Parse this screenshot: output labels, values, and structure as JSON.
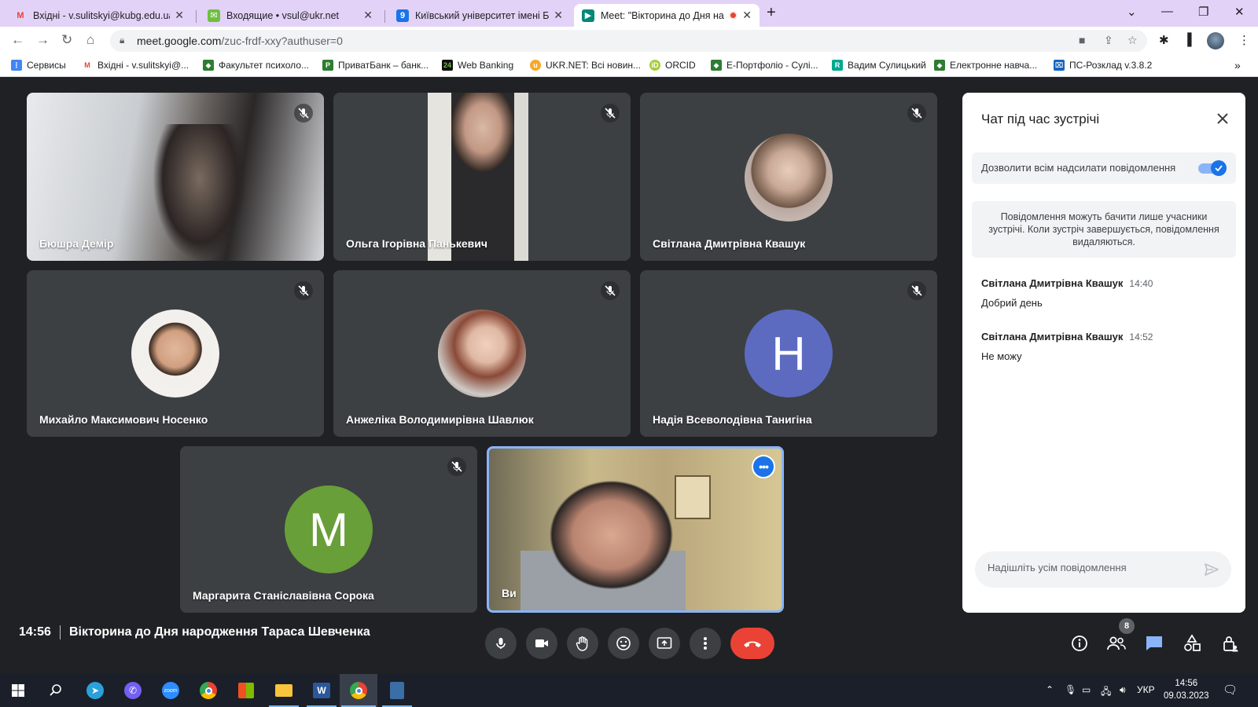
{
  "browser": {
    "tabs": [
      {
        "title": "Вхідні - v.sulitskyi@kubg.edu.ua",
        "icon": "gmail-icon",
        "color": "#ea4335"
      },
      {
        "title": "Входящие • vsul@ukr.net",
        "icon": "ukrnet-mail-icon",
        "color": "#6fbf40"
      },
      {
        "title": "Київський університет імені Бор",
        "icon": "kubg-icon",
        "color": "#1a73e8"
      },
      {
        "title": "Meet: \"Вікторина до Дня на",
        "icon": "meet-icon",
        "color": "#00897b",
        "recording": true
      }
    ],
    "url_host": "meet.google.com",
    "url_path": "/zuc-frdf-xxy?authuser=0",
    "bookmarks": [
      {
        "label": "Сервисы",
        "icon": "apps-grid-icon",
        "color": "#4285f4"
      },
      {
        "label": "Вхідні - v.sulitskyi@...",
        "icon": "gmail-icon",
        "color": "#ea4335"
      },
      {
        "label": "Факультет психоло...",
        "icon": "kubg-icon",
        "color": "#2e7d32"
      },
      {
        "label": "ПриватБанк – банк...",
        "icon": "privatbank-icon",
        "color": "#2e7d32"
      },
      {
        "label": "Web Banking",
        "icon": "bank-icon",
        "color": "#111111"
      },
      {
        "label": "UKR.NET: Всі новин...",
        "icon": "ukrnet-icon",
        "color": "#f9a825"
      },
      {
        "label": "ORCID",
        "icon": "orcid-icon",
        "color": "#a6ce39"
      },
      {
        "label": "Е-Портфоліо - Cулі...",
        "icon": "kubg-icon",
        "color": "#2e7d32"
      },
      {
        "label": "Вадим Сулицький",
        "icon": "researchgate-icon",
        "color": "#00a98f"
      },
      {
        "label": "Електронне навча...",
        "icon": "kubg-icon",
        "color": "#2e7d32"
      },
      {
        "label": "ПС-Розклад v.3.8.2",
        "icon": "schedule-icon",
        "color": "#1565c0"
      }
    ]
  },
  "meet": {
    "participants": [
      {
        "name": "Бюшра Демір",
        "kind": "video"
      },
      {
        "name": "Ольга Ігорівна Панькевич",
        "kind": "video"
      },
      {
        "name": "Світлана Дмитрівна Квашук",
        "kind": "photo",
        "color": "#b9a8a0"
      },
      {
        "name": "Михайло Максимович Носенко",
        "kind": "photo",
        "color": "#e9e6e2"
      },
      {
        "name": "Анжеліка Володимирівна Шавлюк",
        "kind": "photo",
        "color": "#a2756a"
      },
      {
        "name": "Надія Всеволодівна Танигіна",
        "kind": "letter",
        "letter": "Н",
        "color": "#5c6bc0"
      },
      {
        "name": "Маргарита Станіславівна Сорока",
        "kind": "letter",
        "letter": "М",
        "color": "#689f38"
      },
      {
        "name": "Ви",
        "kind": "self"
      }
    ],
    "time": "14:56",
    "meeting_title": "Вікторина до Дня народження Тараса Шевченка",
    "participant_count": "8"
  },
  "chat": {
    "title": "Чат під час зустрічі",
    "toggle_label": "Дозволити всім надсилати повідомлення",
    "toggle_on": true,
    "info": "Повідомлення можуть бачити лише учасники зустрічі. Коли зустріч завершується, повідомлення видаляються.",
    "messages": [
      {
        "sender": "Світлана Дмитрівна Квашук",
        "time": "14:40",
        "text": "Добрий день"
      },
      {
        "sender": "Світлана Дмитрівна Квашук",
        "time": "14:52",
        "text": "Не можу"
      }
    ],
    "input_placeholder": "Надішліть усім повідомлення"
  },
  "taskbar": {
    "language": "УКР",
    "clock_time": "14:56",
    "clock_date": "09.03.2023"
  }
}
